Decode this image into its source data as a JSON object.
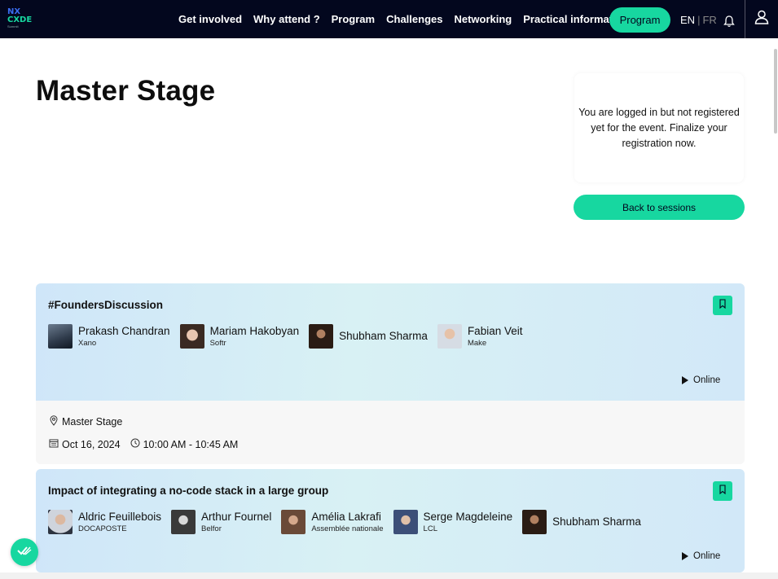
{
  "header": {
    "logo": {
      "line1": "NX",
      "line2": "CXDE",
      "line3": "Summit"
    },
    "nav": [
      "Get involved",
      "Why attend ?",
      "Program",
      "Challenges",
      "Networking",
      "Practical information"
    ],
    "program_button": "Program",
    "lang": {
      "en": "EN",
      "sep": "|",
      "fr": "FR"
    }
  },
  "page": {
    "title": "Master Stage",
    "notice": "You are logged in but not registered yet for the event. Finalize your registration now.",
    "back_button": "Back to sessions"
  },
  "sessions": [
    {
      "title": "#FoundersDiscussion",
      "speakers": [
        {
          "name": "Prakash Chandran",
          "org": "Xano"
        },
        {
          "name": "Mariam Hakobyan",
          "org": "Softr"
        },
        {
          "name": "Shubham Sharma",
          "org": ""
        },
        {
          "name": "Fabian Veit",
          "org": "Make"
        }
      ],
      "mode": "Online",
      "location": "Master Stage",
      "date": "Oct 16, 2024",
      "time": "10:00 AM - 10:45 AM"
    },
    {
      "title": "Impact of integrating a no-code stack in a large group",
      "speakers": [
        {
          "name": "Aldric Feuillebois",
          "org": "DOCAPOSTE"
        },
        {
          "name": "Arthur Fournel",
          "org": "Belfor"
        },
        {
          "name": "Amélia Lakrafi",
          "org": "Assemblée nationale"
        },
        {
          "name": "Serge Magdeleine",
          "org": "LCL"
        },
        {
          "name": "Shubham Sharma",
          "org": ""
        }
      ],
      "mode": "Online"
    }
  ],
  "colors": {
    "accent": "#17d7a0",
    "header_bg": "#03071e"
  },
  "icons": [
    "bell-icon",
    "user-icon",
    "bookmark-icon",
    "location-pin-icon",
    "calendar-icon",
    "clock-icon",
    "play-icon",
    "check-badge-icon"
  ]
}
